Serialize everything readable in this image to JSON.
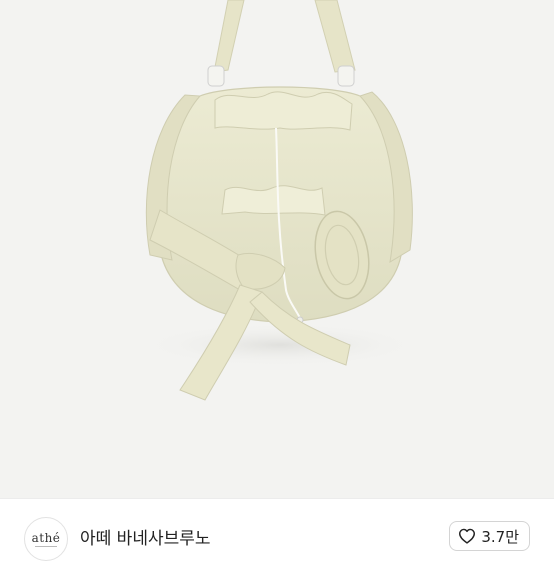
{
  "product": {
    "image_alt": "",
    "brand_logo_text": "athé",
    "title": "아떼 바네사브루노",
    "like_count": "3.7만"
  },
  "icons": {
    "like": "heart-outline-icon"
  },
  "colors": {
    "bag": "#e8e6cc",
    "background": "#f3f3f1"
  }
}
